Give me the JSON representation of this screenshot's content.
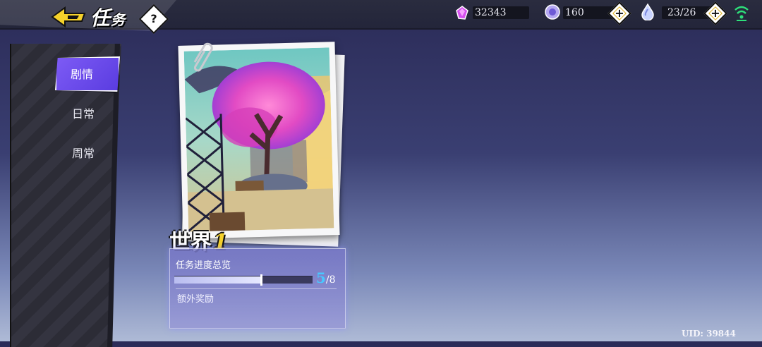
{
  "header": {
    "title_main": "任",
    "title_rest": "务",
    "help_label": "?",
    "resources": [
      {
        "name": "crystal",
        "icon": "crystal-icon",
        "value": "32343"
      },
      {
        "name": "coin",
        "icon": "coin-icon",
        "value": "160"
      },
      {
        "name": "stamina",
        "icon": "droplet-icon",
        "value": "23/26"
      }
    ],
    "plus_label": "+"
  },
  "sidebar": {
    "tabs": [
      {
        "label": "剧情",
        "active": true
      },
      {
        "label": "日常",
        "active": false
      },
      {
        "label": "周常",
        "active": false
      }
    ]
  },
  "card": {
    "world_label": "世界",
    "world_number": "1",
    "progress_label": "任务进度总览",
    "progress_current": "5",
    "progress_total": "/8",
    "progress_fraction": 0.625,
    "extra_reward_label": "额外奖励"
  },
  "footer": {
    "uid": "UID: 39844"
  },
  "colors": {
    "accent_purple": "#6b4ff0",
    "progress_number": "#48c7ff",
    "world_number": "#f5d12b"
  }
}
